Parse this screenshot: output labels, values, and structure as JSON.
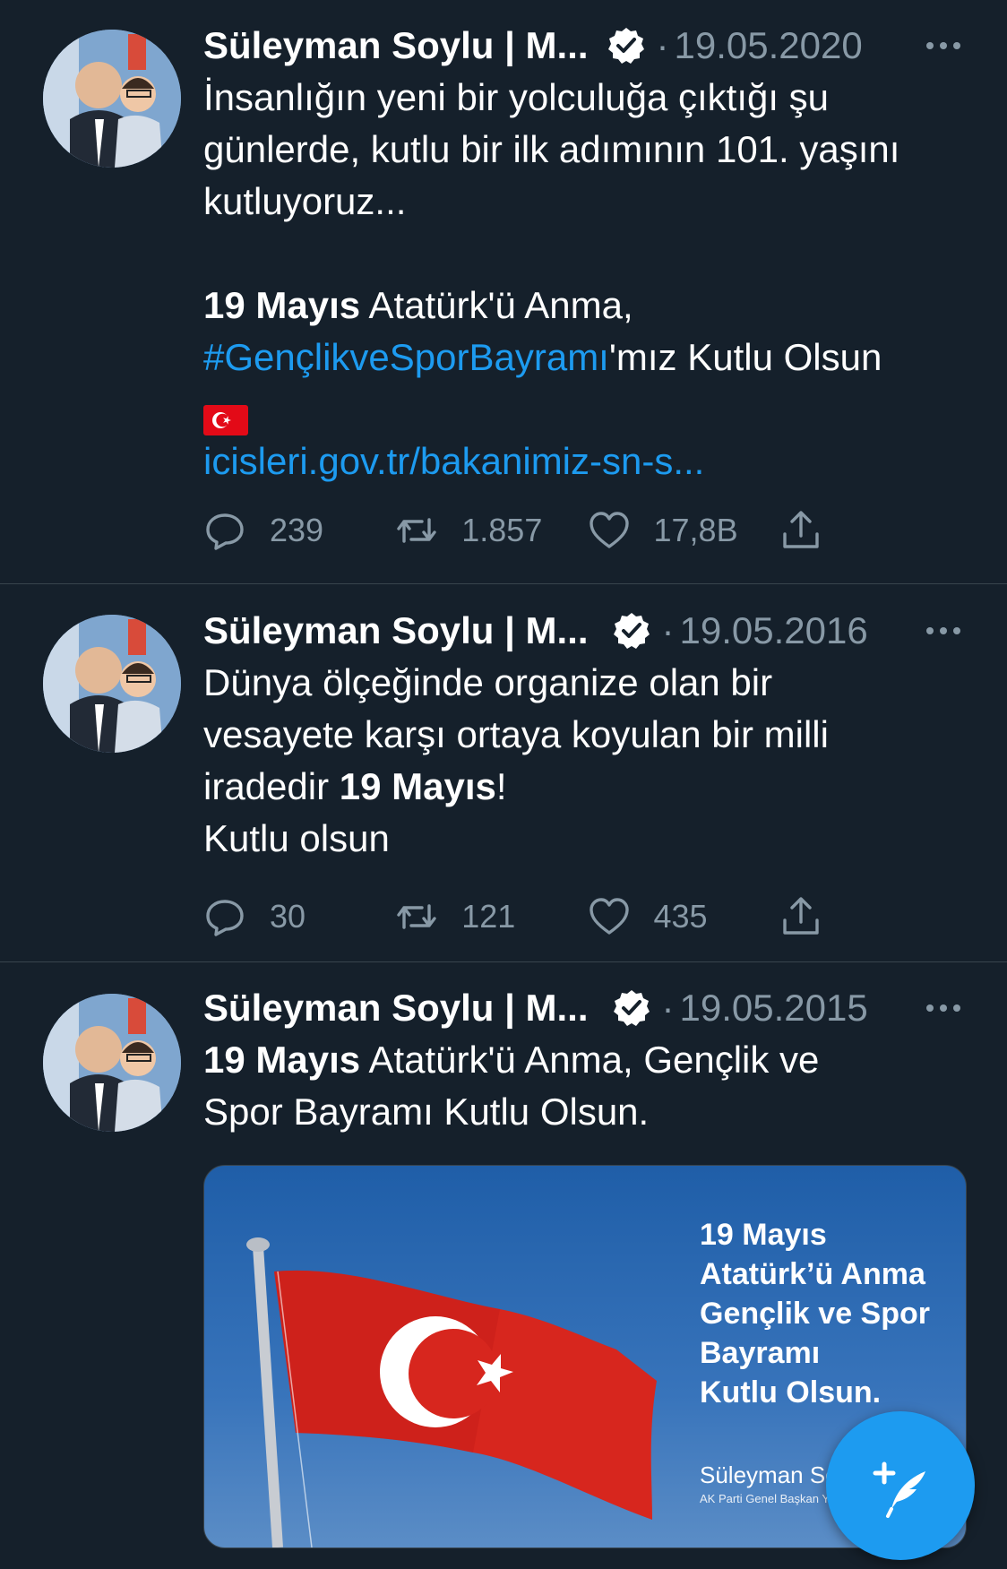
{
  "colors": {
    "background": "#15202b",
    "text": "#ffffff",
    "secondary": "#8899a6",
    "link": "#1d9bf0",
    "divider": "#38444d"
  },
  "tweets": [
    {
      "author": "Süleyman Soylu | M...",
      "date": "19.05.2020",
      "text": {
        "line1": "İnsanlığın yeni bir yolculuğa çıktığı şu",
        "line2": "günlerde, kutlu bir ilk adımının 101. yaşını",
        "line3": "kutluyoruz...",
        "bold": "19 Mayıs",
        "after_bold": " Atatürk'ü Anma,",
        "hashtag": "#GençlikveSporBayramı",
        "after_hashtag": "'mız Kutlu Olsun",
        "link": "icisleri.gov.tr/bakanimiz-sn-s..."
      },
      "replies": "239",
      "retweets": "1.857",
      "likes": "17,8B"
    },
    {
      "author": "Süleyman Soylu | M...",
      "date": "19.05.2016",
      "text": {
        "line1": "Dünya ölçeğinde organize olan bir",
        "line2": "vesayete karşı ortaya koyulan bir milli",
        "line3_pre": "iradedir ",
        "bold": "19 Mayıs",
        "line3_post": "!",
        "line4": "Kutlu olsun"
      },
      "replies": "30",
      "retweets": "121",
      "likes": "435"
    },
    {
      "author": "Süleyman Soylu | M...",
      "date": "19.05.2015",
      "text": {
        "bold": "19 Mayıs",
        "after_bold": " Atatürk'ü Anma, Gençlik ve",
        "line2": "Spor Bayramı Kutlu Olsun."
      },
      "media": {
        "headline": "19 Mayıs\nAtatürk’ü Anma\nGençlik ve Spor\nBayramı\nKutlu Olsun.",
        "signature": "Süleyman Soy",
        "subtitle": "AK Parti Genel Başkan Ya"
      }
    }
  ]
}
